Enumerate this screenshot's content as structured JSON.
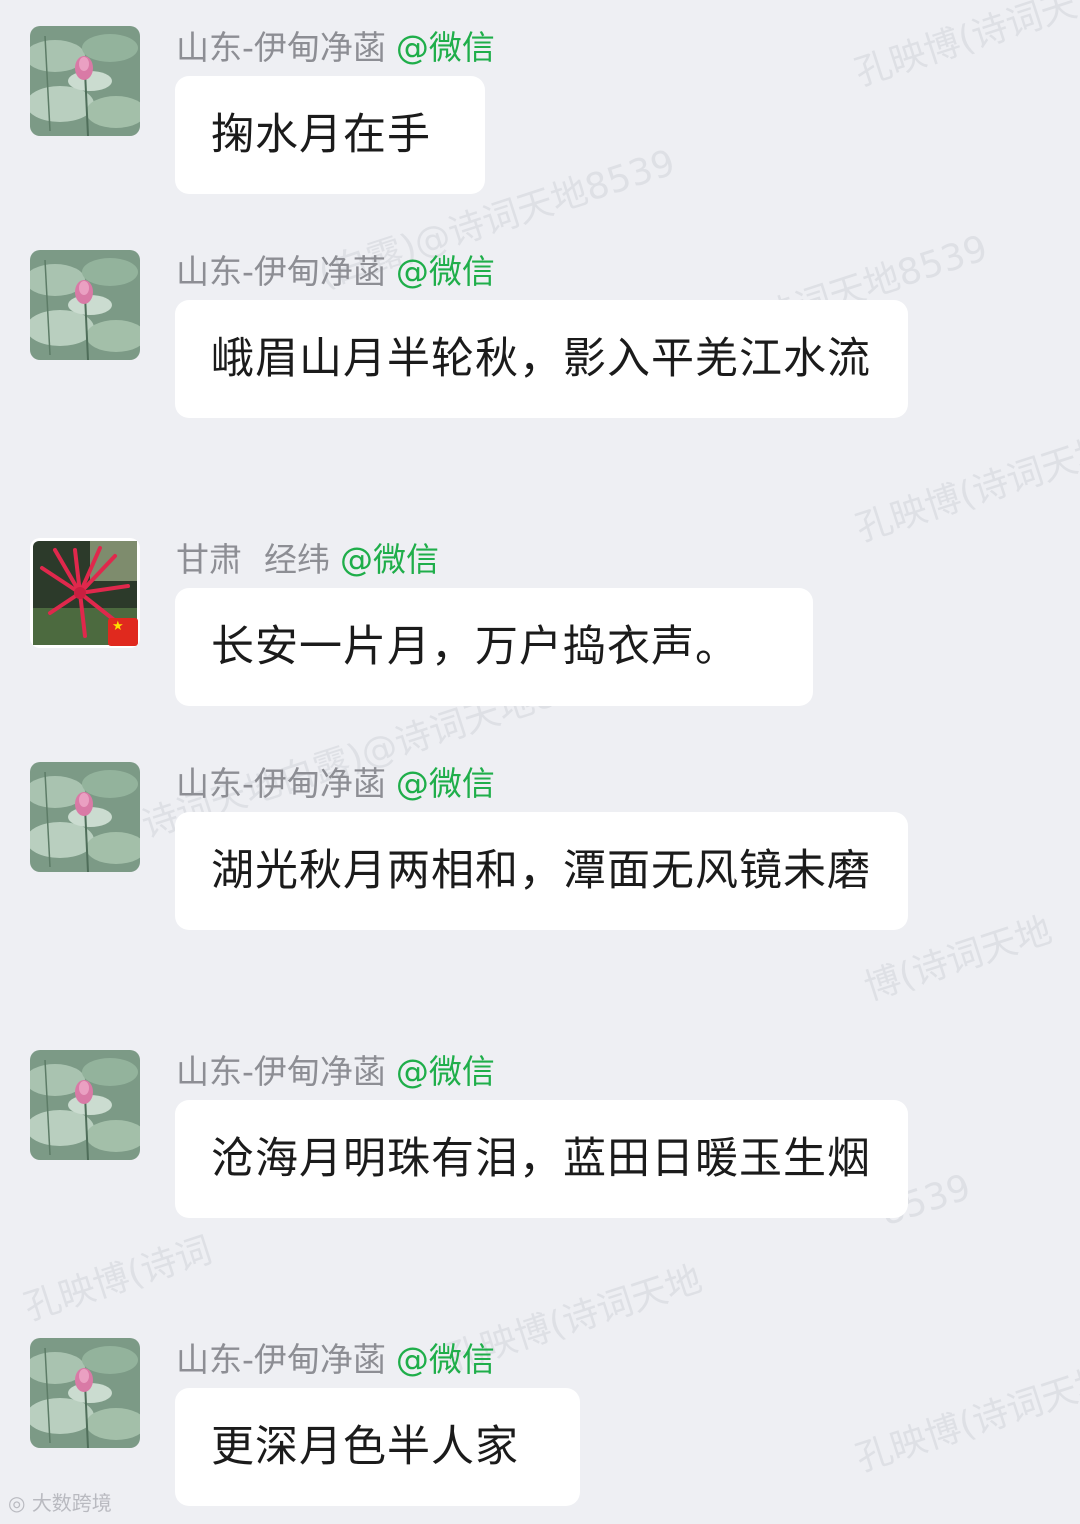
{
  "watermark_text": "孔映博(诗词天地白露)@诗词天地8539",
  "footer_logo": "大数跨境",
  "messages": [
    {
      "avatar": "lotus-avatar",
      "name": "山东-伊甸净菡",
      "platform": "@微信",
      "text": "掬水月在手"
    },
    {
      "avatar": "lotus-avatar",
      "name": "山东-伊甸净菡",
      "platform": "@微信",
      "text": "峨眉山月半轮秋，影入平羌江水流"
    },
    {
      "avatar": "red-flower-avatar",
      "name": "甘肃",
      "name2": "经纬",
      "platform": "@微信",
      "text": "长安一片月，万户捣衣声。"
    },
    {
      "avatar": "lotus-avatar",
      "name": "山东-伊甸净菡",
      "platform": "@微信",
      "text": "湖光秋月两相和，潭面无风镜未磨"
    },
    {
      "avatar": "lotus-avatar",
      "name": "山东-伊甸净菡",
      "platform": "@微信",
      "text": "沧海月明珠有泪，蓝田日暖玉生烟"
    },
    {
      "avatar": "lotus-avatar",
      "name": "山东-伊甸净菡",
      "platform": "@微信",
      "text": "更深月色半人家"
    }
  ],
  "colors": {
    "background": "#eeeff3",
    "bubble": "#ffffff",
    "sender_name": "#8d8e94",
    "platform_accent": "#1fae4a"
  }
}
